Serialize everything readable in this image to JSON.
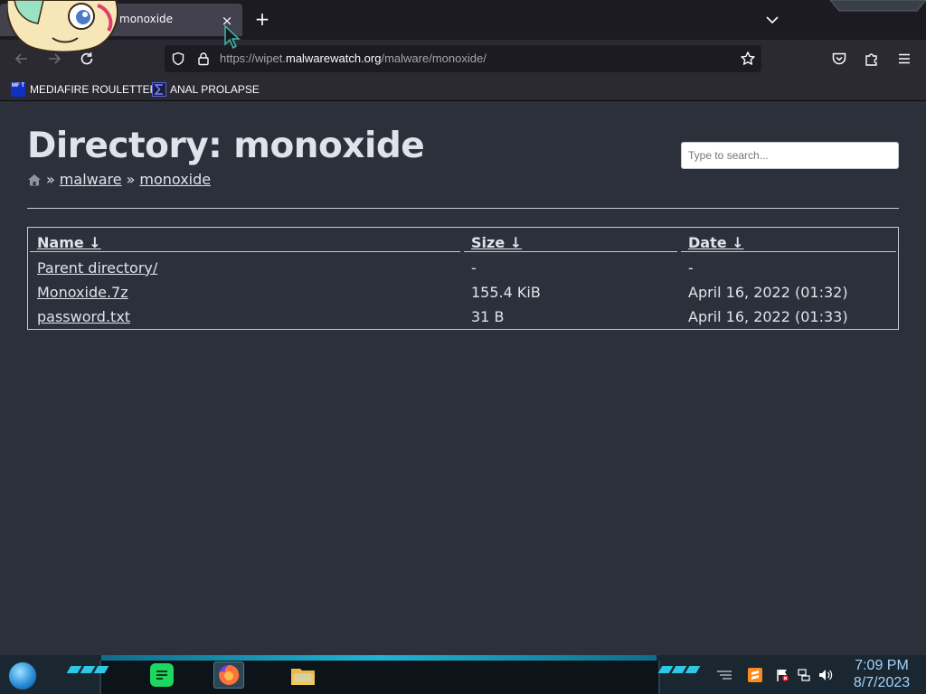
{
  "browser": {
    "tab": {
      "title": "monoxide",
      "close_symbol": "×"
    },
    "new_tab_symbol": "+",
    "url": {
      "prefix": "https://wipet.",
      "host": "malwarewatch.org",
      "path": "/malware/monoxide/"
    },
    "bookmarks": [
      {
        "label": "MEDIAFIRE ROULETTER",
        "favicon_text": "MF T"
      },
      {
        "label": "ANAL PROLAPSE"
      }
    ]
  },
  "page": {
    "title": "Directory: monoxide",
    "search_placeholder": "Type to search...",
    "breadcrumb": {
      "separator": "»",
      "items": [
        "malware",
        "monoxide"
      ]
    },
    "table": {
      "headers": {
        "name": "Name ↓",
        "size": "Size ↓",
        "date": "Date ↓"
      },
      "rows": [
        {
          "name": "Parent directory/",
          "size": "-",
          "date": "-"
        },
        {
          "name": "Monoxide.7z",
          "size": "155.4 KiB",
          "date": "April 16, 2022 (01:32)"
        },
        {
          "name": "password.txt",
          "size": "31 B",
          "date": "April 16, 2022 (01:33)"
        }
      ]
    }
  },
  "taskbar": {
    "apps": [
      "spotify-icon",
      "firefox-icon",
      "file-explorer-icon"
    ],
    "tray": [
      "sublime-text-icon",
      "flag-icon",
      "network-icon",
      "volume-icon"
    ],
    "clock": {
      "time": "7:09 PM",
      "date": "8/7/2023"
    }
  },
  "colors": {
    "page_background": "#2b303b",
    "text": "#e0e3ea",
    "browser_chrome": "#2b2a33",
    "accent_cyan": "#2ec7e6"
  }
}
